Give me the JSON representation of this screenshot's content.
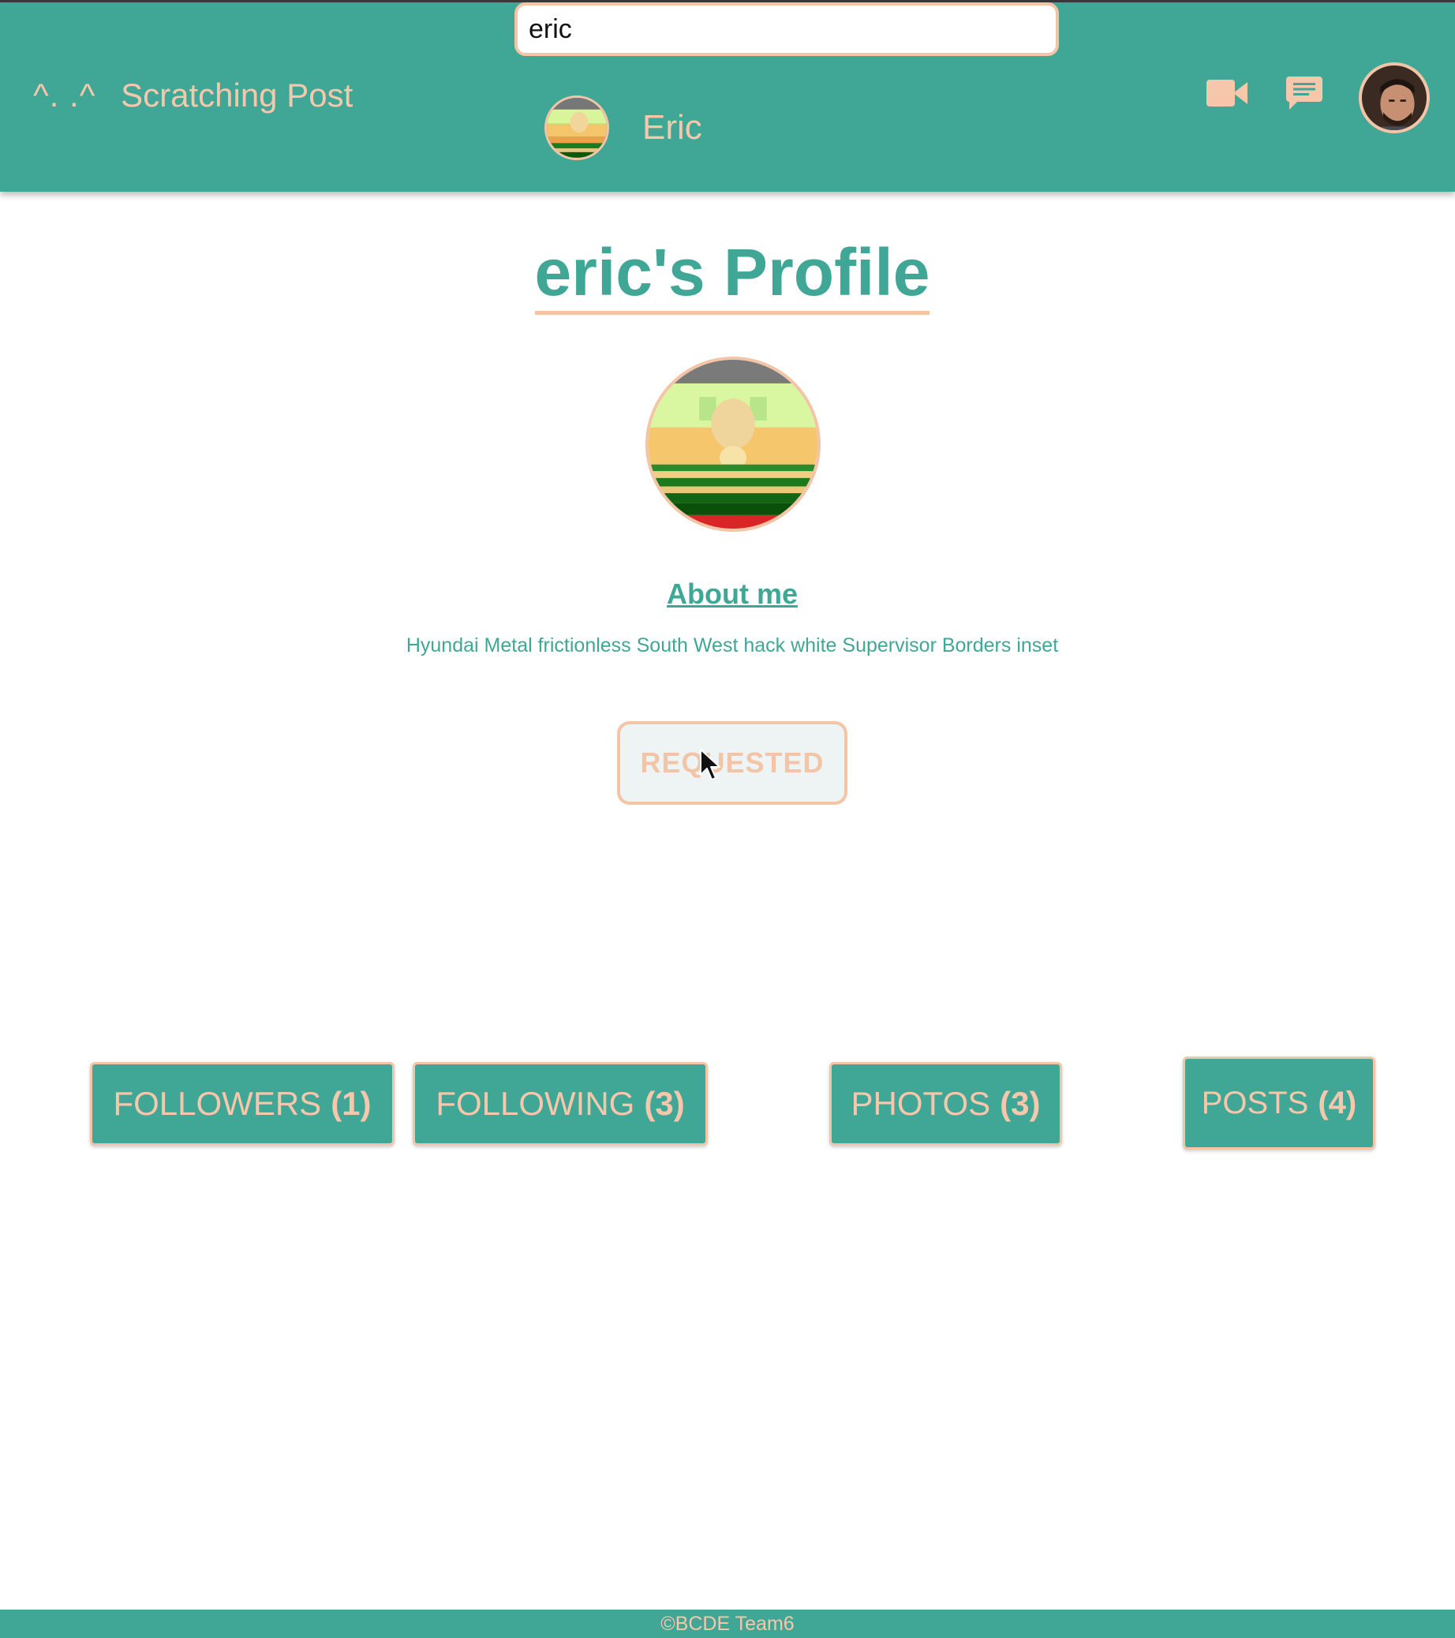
{
  "colors": {
    "primary": "#40a796",
    "accent": "#f3c4a6",
    "background": "#ffffff"
  },
  "header": {
    "brand_logo": "^. .^",
    "brand_name": "Scratching Post",
    "search_value": "eric",
    "search_result_name": "Eric",
    "icons": [
      "video-camera-icon",
      "chat-bubble-icon"
    ]
  },
  "profile": {
    "title": "eric's Profile",
    "about_heading": "About me",
    "about_text": "Hyundai Metal frictionless South West hack white Supervisor Borders inset",
    "request_button_label": "REQUESTED"
  },
  "stats": {
    "followers_label": "FOLLOWERS",
    "followers_count": "(1)",
    "following_label": "FOLLOWING",
    "following_count": "(3)",
    "photos_label": "PHOTOS",
    "photos_count": "(3)",
    "posts_label": "POSTS",
    "posts_count": "(4)"
  },
  "footer": {
    "text": "©BCDE Team6"
  }
}
